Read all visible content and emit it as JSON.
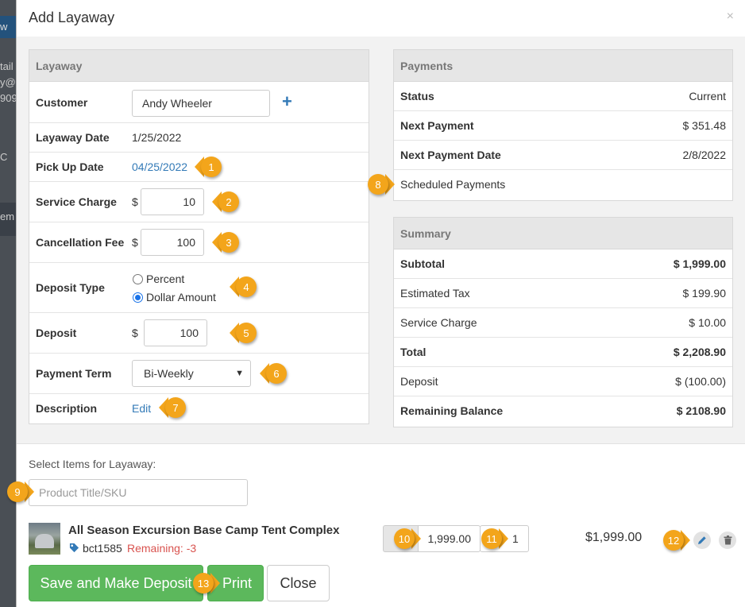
{
  "backdrop": {
    "texts": [
      "w",
      "tail",
      "y@",
      "909",
      "C",
      "em"
    ]
  },
  "modal": {
    "title": "Add Layaway",
    "close_glyph": "×"
  },
  "layaway": {
    "header": "Layaway",
    "customer_label": "Customer",
    "customer_value": "Andy Wheeler",
    "add_glyph": "+",
    "layaway_date_label": "Layaway Date",
    "layaway_date_value": "1/25/2022",
    "pickup_date_label": "Pick Up Date",
    "pickup_date_value": "04/25/2022",
    "service_charge_label": "Service Charge",
    "service_charge_value": "10",
    "cancellation_fee_label": "Cancellation Fee",
    "cancellation_fee_value": "100",
    "currency_symbol": "$",
    "deposit_type_label": "Deposit Type",
    "deposit_type_options": [
      "Percent",
      "Dollar Amount"
    ],
    "deposit_type_selected": "Dollar Amount",
    "deposit_label": "Deposit",
    "deposit_value": "100",
    "payment_term_label": "Payment Term",
    "payment_term_value": "Bi-Weekly",
    "description_label": "Description",
    "description_link": "Edit"
  },
  "payments": {
    "header": "Payments",
    "status_label": "Status",
    "status_value": "Current",
    "next_payment_label": "Next Payment",
    "next_payment_value": "$ 351.48",
    "next_payment_date_label": "Next Payment Date",
    "next_payment_date_value": "2/8/2022",
    "scheduled_payments_link": "Scheduled Payments"
  },
  "summary": {
    "header": "Summary",
    "rows": [
      {
        "label": "Subtotal",
        "value": "$ 1,999.00",
        "bold": true
      },
      {
        "label": "Estimated Tax",
        "value": "$ 199.90",
        "bold": false
      },
      {
        "label": "Service Charge",
        "value": "$ 10.00",
        "bold": false
      },
      {
        "label": "Total",
        "value": "$ 2,208.90",
        "bold": true
      },
      {
        "label": "Deposit",
        "value": "$ (100.00)",
        "bold": false
      },
      {
        "label": "Remaining Balance",
        "value": "$ 2108.90",
        "bold": true
      }
    ]
  },
  "items": {
    "select_label": "Select Items for Layaway:",
    "search_placeholder": "Product Title/SKU",
    "product": {
      "title": "All Season Excursion Base Camp Tent Complex",
      "sku": "bct1585",
      "remaining": "Remaining: -3",
      "price": "1,999.00",
      "quantity": "1",
      "line_total": "$1,999.00"
    }
  },
  "buttons": {
    "save_deposit": "Save and Make Deposit",
    "print": "Print",
    "close": "Close"
  },
  "callouts": [
    "1",
    "2",
    "3",
    "4",
    "5",
    "6",
    "7",
    "8",
    "9",
    "10",
    "11",
    "12",
    "13"
  ],
  "colors": {
    "accent": "#337ab7",
    "callout": "#f3a51b",
    "success": "#5cb85c",
    "danger": "#d9534f"
  }
}
